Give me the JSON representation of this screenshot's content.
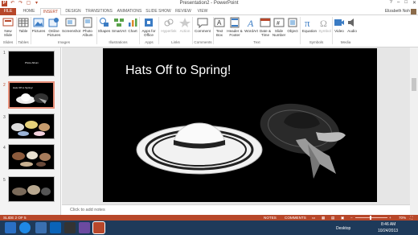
{
  "window": {
    "title": "Presentation2 - PowerPoint",
    "controls": [
      "?",
      "–",
      "□",
      "✕"
    ]
  },
  "quick_access": [
    "P",
    "↶",
    "↷",
    "▢",
    "▾"
  ],
  "tabs": [
    "FILE",
    "HOME",
    "INSERT",
    "DESIGN",
    "TRANSITIONS",
    "ANIMATIONS",
    "SLIDE SHOW",
    "REVIEW",
    "VIEW"
  ],
  "active_tab": "INSERT",
  "user": {
    "name": "Elizabeth Noh"
  },
  "ribbon": {
    "buttons": [
      {
        "label": "New Slide",
        "icon": "new-slide-icon"
      },
      {
        "label": "Table",
        "icon": "table-icon"
      },
      {
        "label": "Pictures",
        "icon": "pictures-icon"
      },
      {
        "label": "Online Pictures",
        "icon": "online-pictures-icon"
      },
      {
        "label": "Screenshot",
        "icon": "screenshot-icon"
      },
      {
        "label": "Photo Album",
        "icon": "photo-album-icon"
      },
      {
        "label": "Shapes",
        "icon": "shapes-icon"
      },
      {
        "label": "SmartArt",
        "icon": "smartart-icon"
      },
      {
        "label": "Chart",
        "icon": "chart-icon"
      },
      {
        "label": "Apps for Office",
        "icon": "apps-icon"
      },
      {
        "label": "Hyperlink",
        "icon": "hyperlink-icon"
      },
      {
        "label": "Action",
        "icon": "action-icon"
      },
      {
        "label": "Comment",
        "icon": "comment-icon"
      },
      {
        "label": "Text Box",
        "icon": "textbox-icon"
      },
      {
        "label": "Header & Footer",
        "icon": "header-footer-icon"
      },
      {
        "label": "WordArt",
        "icon": "wordart-icon"
      },
      {
        "label": "Date & Time",
        "icon": "date-time-icon"
      },
      {
        "label": "Slide Number",
        "icon": "slide-number-icon"
      },
      {
        "label": "Object",
        "icon": "object-icon"
      },
      {
        "label": "Equation",
        "icon": "equation-icon"
      },
      {
        "label": "Symbol",
        "icon": "symbol-icon"
      },
      {
        "label": "Video",
        "icon": "video-icon"
      },
      {
        "label": "Audio",
        "icon": "audio-icon"
      }
    ],
    "groups": [
      "Slides",
      "Tables",
      "Images",
      "Illustrations",
      "Apps",
      "Links",
      "Comments",
      "Text",
      "Symbols",
      "Media"
    ]
  },
  "thumbnails": [
    {
      "number": "1",
      "title": "Photo Album",
      "selected": false
    },
    {
      "number": "2",
      "title": "Hats Off to Spring!",
      "selected": true
    },
    {
      "number": "3",
      "title": "",
      "selected": false
    },
    {
      "number": "4",
      "title": "",
      "selected": false
    },
    {
      "number": "5",
      "title": "",
      "selected": false
    }
  ],
  "slide": {
    "title": "Hats Off to Spring!"
  },
  "notes": {
    "placeholder": "Click to add notes"
  },
  "status": {
    "slide_info": "SLIDE 2 OF 5",
    "notes_label": "NOTES",
    "comments_label": "COMMENTS",
    "zoom": "70%"
  },
  "taskbar": {
    "desktop_label": "Desktop",
    "time": "8:46 AM",
    "date": "10/24/2013"
  },
  "colors": {
    "accent": "#b7472a",
    "taskbar": "#1e3a5a",
    "slide_bg": "#000000"
  }
}
